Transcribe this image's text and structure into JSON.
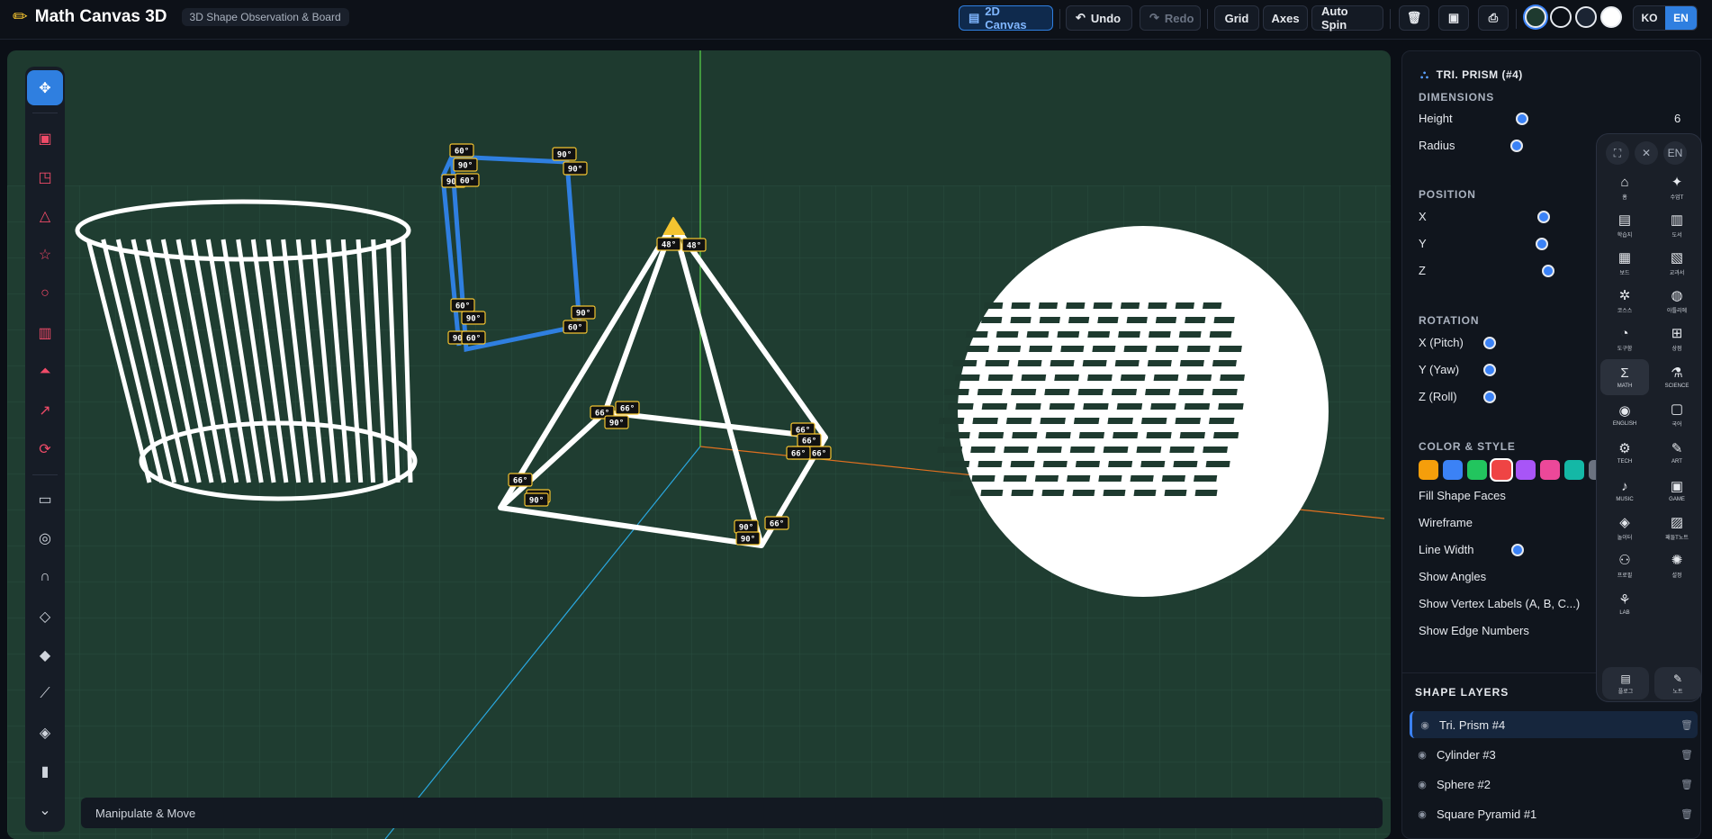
{
  "header": {
    "app_title": "Math Canvas 3D",
    "subtitle": "3D Shape Observation & Board",
    "btn_2d": "2D Canvas",
    "btn_undo": "Undo",
    "btn_redo": "Redo",
    "btn_grid": "Grid",
    "btn_axes": "Axes",
    "btn_spin": "Auto Spin",
    "lang_ko": "KO",
    "lang_en": "EN"
  },
  "status": "Manipulate & Move",
  "panel": {
    "title": "TRI. PRISM (#4)",
    "dimensions": "DIMENSIONS",
    "height_label": "Height",
    "height_value": "6",
    "radius_label": "Radius",
    "position": "POSITION",
    "x": "X",
    "y": "Y",
    "z": "Z",
    "rotation": "ROTATION",
    "pitch": "X (Pitch)",
    "yaw": "Y (Yaw)",
    "roll": "Z (Roll)",
    "color_style": "COLOR & STYLE",
    "fill_faces": "Fill Shape Faces",
    "wireframe": "Wireframe",
    "line_width": "Line Width",
    "show_angles": "Show Angles",
    "vertex_labels": "Show Vertex Labels (A, B, C...)",
    "edge_numbers": "Show Edge Numbers",
    "colors": [
      "#f59e0b",
      "#3b82f6",
      "#22c55e",
      "#ef4444",
      "#a855f7",
      "#ec4899",
      "#14b8a6",
      "#6b7280"
    ]
  },
  "layers": {
    "title": "SHAPE LAYERS",
    "items": [
      "Tri. Prism #4",
      "Cylinder #3",
      "Sphere #2",
      "Square Pyramid #1"
    ]
  },
  "launcher": {
    "lang": "EN",
    "apps": [
      {
        "label": "홈",
        "icon": "⌂"
      },
      {
        "label": "수업T",
        "icon": "✦"
      },
      {
        "label": "학습지",
        "icon": "▤"
      },
      {
        "label": "도서",
        "icon": "▥"
      },
      {
        "label": "보드",
        "icon": "▦"
      },
      {
        "label": "교과서",
        "icon": "▧"
      },
      {
        "label": "코스스",
        "icon": "✲"
      },
      {
        "label": "아틀리에",
        "icon": "◍"
      },
      {
        "label": "도구함",
        "icon": "◔"
      },
      {
        "label": "상점",
        "icon": "⊞"
      },
      {
        "label": "MATH",
        "icon": "Σ"
      },
      {
        "label": "SCIENCE",
        "icon": "⚗"
      },
      {
        "label": "ENGLISH",
        "icon": "◉"
      },
      {
        "label": "국어",
        "icon": "▢"
      },
      {
        "label": "TECH",
        "icon": "⚙"
      },
      {
        "label": "ART",
        "icon": "✎"
      },
      {
        "label": "MUSIC",
        "icon": "♪"
      },
      {
        "label": "GAME",
        "icon": "▣"
      },
      {
        "label": "놀이터",
        "icon": "◈"
      },
      {
        "label": "패들T노트",
        "icon": "▨"
      },
      {
        "label": "프로필",
        "icon": "⚇"
      },
      {
        "label": "설정",
        "icon": "✺"
      },
      {
        "label": "LAB",
        "icon": "⚘"
      }
    ],
    "bottom": [
      {
        "label": "플로그",
        "icon": "▤"
      },
      {
        "label": "노트",
        "icon": "✎"
      }
    ]
  },
  "angles": [
    "60°",
    "90°",
    "90°",
    "60°",
    "90°",
    "90°",
    "60°",
    "90°",
    "90°",
    "60°",
    "90°",
    "60°",
    "48°",
    "48°",
    "66°",
    "66°",
    "90°",
    "66°",
    "66°",
    "66°",
    "66°",
    "66°",
    "90°",
    "66°",
    "90°",
    "66°",
    "66°",
    "90°"
  ]
}
